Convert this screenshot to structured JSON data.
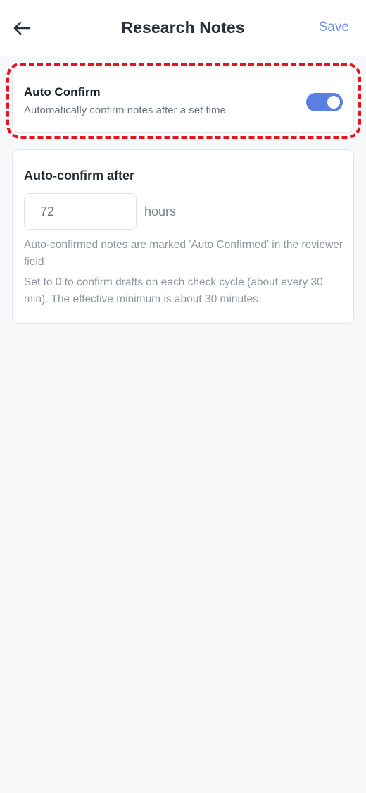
{
  "header": {
    "title": "Research Notes",
    "save_label": "Save",
    "back_icon": "arrow-left-icon"
  },
  "auto_confirm": {
    "title": "Auto Confirm",
    "subtitle": "Automatically confirm notes after a set time",
    "enabled": true,
    "switch_color": "#5b7fe0"
  },
  "settings": {
    "section_title": "Auto-confirm after",
    "hours_value": "72",
    "unit_label": "hours",
    "help_text_1": "Auto-confirmed notes are marked 'Auto Confirmed' in the reviewer field",
    "help_text_2": "Set to 0 to confirm drafts on each check cycle (about every 30 min). The effective minimum is about 30 minutes."
  },
  "colors": {
    "accent": "#6b8ce8",
    "highlight": "#e8141c"
  }
}
